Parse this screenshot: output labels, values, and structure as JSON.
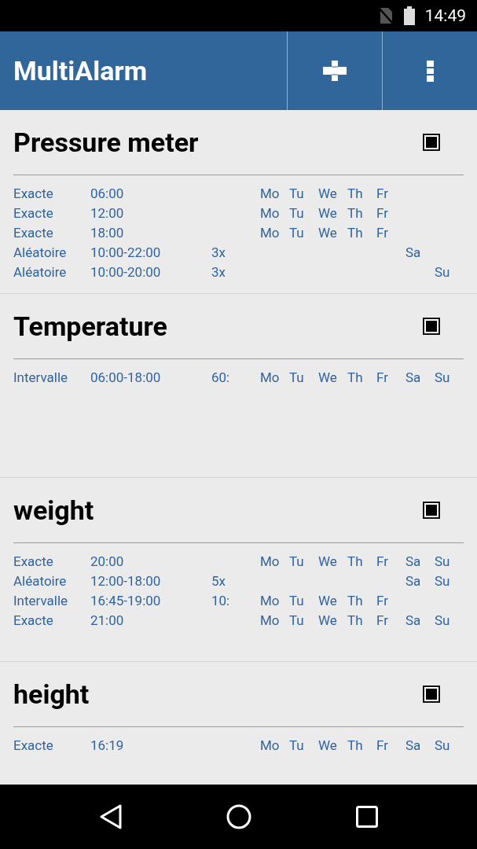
{
  "status_bar": {
    "time": "14:49"
  },
  "app_bar": {
    "title": "MultiAlarm"
  },
  "groups": [
    {
      "title": "Pressure meter",
      "checked": true,
      "alarms": [
        {
          "type": "Exacte",
          "time": "06:00",
          "days": [
            {
              "label": "Mo",
              "kind": "monday"
            },
            {
              "label": "Tu",
              "kind": "tuesday"
            },
            {
              "label": "We",
              "kind": "wednesday"
            },
            {
              "label": "Th",
              "kind": "thursday"
            },
            {
              "label": "Fr",
              "kind": "friday"
            }
          ]
        },
        {
          "type": "Exacte",
          "time": "12:00",
          "days": [
            {
              "label": "Mo",
              "kind": "monday"
            },
            {
              "label": "Tu",
              "kind": "tuesday"
            },
            {
              "label": "We",
              "kind": "wednesday"
            },
            {
              "label": "Th",
              "kind": "thursday"
            },
            {
              "label": "Fr",
              "kind": "friday"
            }
          ]
        },
        {
          "type": "Exacte",
          "time": "18:00",
          "days": [
            {
              "label": "Mo",
              "kind": "monday"
            },
            {
              "label": "Tu",
              "kind": "tuesday"
            },
            {
              "label": "We",
              "kind": "wednesday"
            },
            {
              "label": "Th",
              "kind": "thursday"
            },
            {
              "label": "Fr",
              "kind": "friday"
            }
          ]
        },
        {
          "type": "Aléatoire",
          "time": "10:00-22:00",
          "count": "3x",
          "days": [
            {
              "label": "Sa",
              "kind": "saturday"
            }
          ]
        },
        {
          "type": "Aléatoire",
          "time": "10:00-20:00",
          "count": "3x",
          "days": [
            {
              "label": "Su",
              "kind": "sunday"
            }
          ]
        }
      ]
    },
    {
      "title": "Temperature",
      "checked": true,
      "alarms": [
        {
          "type": "Intervalle",
          "time": "06:00-18:00",
          "count": "60:",
          "days": [
            {
              "label": "Mo",
              "kind": "monday"
            },
            {
              "label": "Tu",
              "kind": "tuesday"
            },
            {
              "label": "We",
              "kind": "wednesday"
            },
            {
              "label": "Th",
              "kind": "thursday"
            },
            {
              "label": "Fr",
              "kind": "friday"
            },
            {
              "label": "Sa",
              "kind": "saturday"
            },
            {
              "label": "Su",
              "kind": "sunday"
            }
          ]
        }
      ]
    },
    {
      "title": "weight",
      "checked": true,
      "alarms": [
        {
          "type": "Exacte",
          "time": "20:00",
          "days": [
            {
              "label": "Mo",
              "kind": "monday"
            },
            {
              "label": "Tu",
              "kind": "tuesday"
            },
            {
              "label": "We",
              "kind": "wednesday"
            },
            {
              "label": "Th",
              "kind": "thursday"
            },
            {
              "label": "Fr",
              "kind": "friday"
            },
            {
              "label": "Sa",
              "kind": "saturday"
            },
            {
              "label": "Su",
              "kind": "sunday"
            }
          ]
        },
        {
          "type": "Aléatoire",
          "time": "12:00-18:00",
          "count": "5x",
          "days": [
            {
              "label": "Sa",
              "kind": "saturday"
            },
            {
              "label": "Su",
              "kind": "sunday"
            }
          ]
        },
        {
          "type": "Intervalle",
          "time": "16:45-19:00",
          "count": "10:",
          "days": [
            {
              "label": "Mo",
              "kind": "monday"
            },
            {
              "label": "Tu",
              "kind": "tuesday"
            },
            {
              "label": "We",
              "kind": "wednesday"
            },
            {
              "label": "Th",
              "kind": "thursday"
            },
            {
              "label": "Fr",
              "kind": "friday"
            }
          ]
        },
        {
          "type": "Exacte",
          "time": "21:00",
          "days": [
            {
              "label": "Mo",
              "kind": "monday"
            },
            {
              "label": "Tu",
              "kind": "tuesday"
            },
            {
              "label": "We",
              "kind": "wednesday"
            },
            {
              "label": "Th",
              "kind": "thursday"
            },
            {
              "label": "Fr",
              "kind": "friday"
            },
            {
              "label": "Sa",
              "kind": "saturday"
            },
            {
              "label": "Su",
              "kind": "sunday"
            }
          ]
        }
      ]
    },
    {
      "title": "height",
      "checked": true,
      "alarms": [
        {
          "type": "Exacte",
          "time": "16:19",
          "days": [
            {
              "label": "Mo",
              "kind": "monday"
            },
            {
              "label": "Tu",
              "kind": "tuesday"
            },
            {
              "label": "We",
              "kind": "wednesday"
            },
            {
              "label": "Th",
              "kind": "thursday"
            },
            {
              "label": "Fr",
              "kind": "friday"
            },
            {
              "label": "Sa",
              "kind": "saturday"
            },
            {
              "label": "Su",
              "kind": "sunday"
            }
          ]
        }
      ]
    }
  ]
}
